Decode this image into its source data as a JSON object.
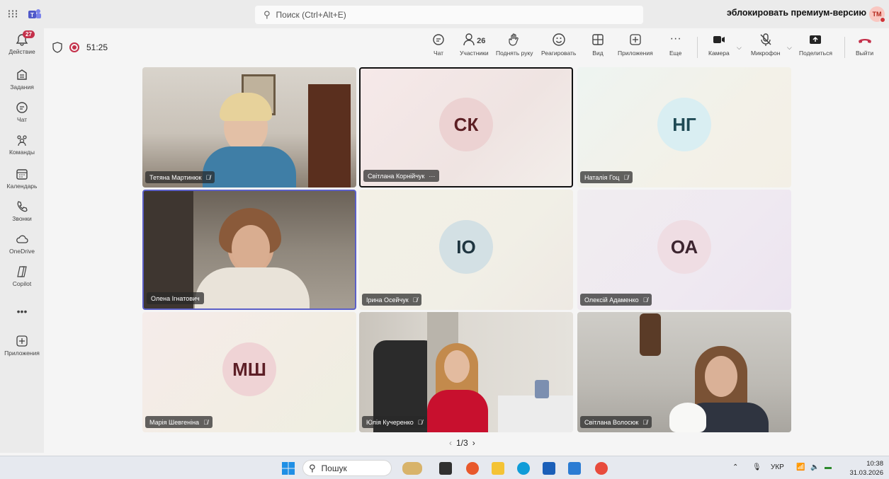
{
  "titlebar": {
    "search_placeholder": "Поиск (Ctrl+Alt+E)",
    "premium_text": "эблокировать премиум-версию",
    "avatar_initials": "TM"
  },
  "rail": {
    "items": [
      {
        "label": "Действие",
        "icon": "bell-icon",
        "badge": "27"
      },
      {
        "label": "Задания",
        "icon": "assignments-icon"
      },
      {
        "label": "Чат",
        "icon": "chat-icon"
      },
      {
        "label": "Команды",
        "icon": "teams-icon"
      },
      {
        "label": "Календарь",
        "icon": "calendar-icon"
      },
      {
        "label": "Звонки",
        "icon": "phone-icon"
      },
      {
        "label": "OneDrive",
        "icon": "cloud-icon"
      },
      {
        "label": "Copilot",
        "icon": "copilot-icon"
      },
      {
        "label": "•••",
        "icon": "more-icon"
      },
      {
        "label": "Приложения",
        "icon": "add-app-icon"
      }
    ]
  },
  "meeting": {
    "timer": "51:25",
    "participants_count": "26",
    "tools": {
      "chat": "Чат",
      "participants": "Участники",
      "raise_hand": "Поднять руку",
      "react": "Реагировать",
      "view": "Вид",
      "apps": "Приложения",
      "more": "Еще",
      "camera": "Камера",
      "mic": "Микрофон",
      "share": "Поделиться",
      "leave": "Выйти"
    }
  },
  "tiles": [
    {
      "name": "Тетяна Мартинюк",
      "initials": "",
      "video": true
    },
    {
      "name": "Світлана Корнійчук",
      "initials": "СК",
      "video": false
    },
    {
      "name": "Наталія Гоц",
      "initials": "НГ",
      "video": false
    },
    {
      "name": "Олена Ігнатович",
      "initials": "",
      "video": true
    },
    {
      "name": "Ірина Осейчук",
      "initials": "ІО",
      "video": false
    },
    {
      "name": "Олексій Адаменко",
      "initials": "ОА",
      "video": false
    },
    {
      "name": "Марія Шевгеніна",
      "initials": "МШ",
      "video": false
    },
    {
      "name": "Юлія Кучеренко",
      "initials": "",
      "video": true
    },
    {
      "name": "Світлана Волосюк",
      "initials": "",
      "video": true
    }
  ],
  "pager": {
    "label": "1/3"
  },
  "taskbar": {
    "search_placeholder": "Пошук",
    "lang": "УКР",
    "time": "10:38",
    "date": "31.03.2026"
  },
  "colors": {
    "accent": "#5b5fc7",
    "leave": "#c4314b",
    "badge": "#c4314b"
  }
}
